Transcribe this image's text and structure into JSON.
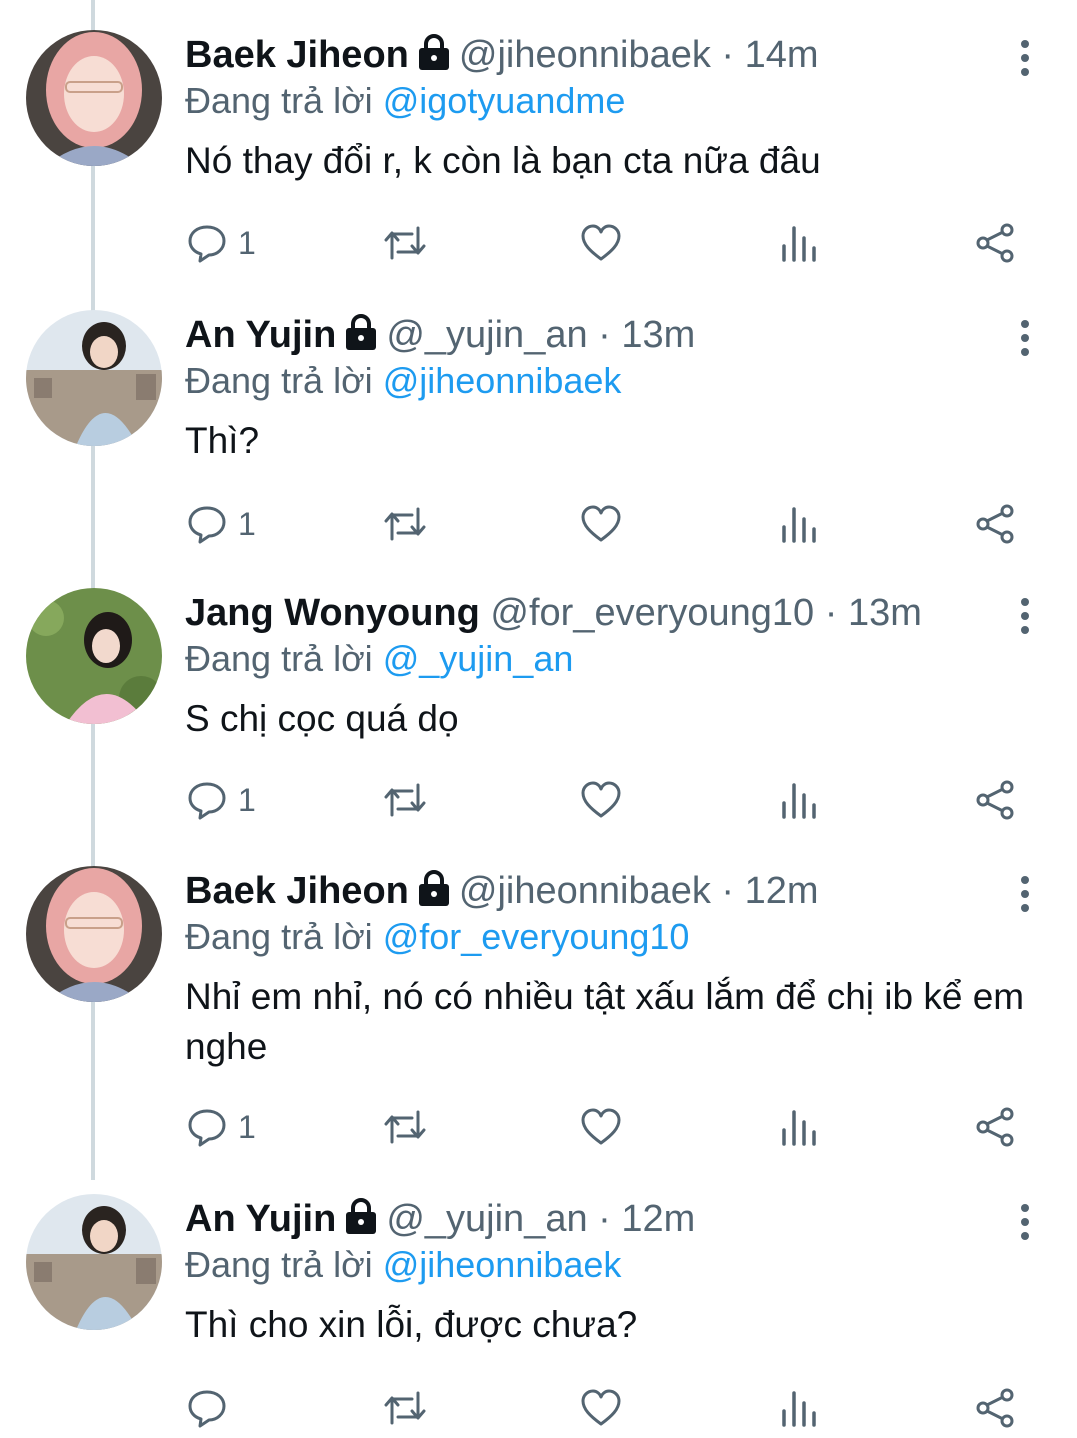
{
  "ui": {
    "reply_prefix": "Đang trả lời",
    "dot": "·"
  },
  "colors": {
    "text": "#0f1419",
    "secondary": "#536471",
    "link": "#1d9bf0",
    "thread_line": "#cfd9de"
  },
  "tweets": [
    {
      "name": "Baek Jiheon",
      "handle": "@jiheonnibaek",
      "time": "14m",
      "reply_to": "@igotyuandme",
      "text": "Nó thay đổi r, k còn là bạn cta nữa đâu",
      "reply_count": "1",
      "avatar": "pink-hair-avatar",
      "locked": true
    },
    {
      "name": "An Yujin",
      "handle": "@_yujin_an",
      "time": "13m",
      "reply_to": "@jiheonnibaek",
      "text": "Thì?",
      "reply_count": "1",
      "avatar": "city-view-avatar",
      "locked": true
    },
    {
      "name": "Jang Wonyoung",
      "handle": "@for_everyoung10",
      "time": "13m",
      "reply_to": "@_yujin_an",
      "text": "S chị cọc quá dọ",
      "reply_count": "1",
      "avatar": "grass-field-avatar",
      "locked": false
    },
    {
      "name": "Baek Jiheon",
      "handle": "@jiheonnibaek",
      "time": "12m",
      "reply_to": "@for_everyoung10",
      "text": "Nhỉ em nhỉ, nó có nhiều tật xấu lắm để chị ib kể em nghe",
      "reply_count": "1",
      "avatar": "pink-hair-avatar",
      "locked": true
    },
    {
      "name": "An Yujin",
      "handle": "@_yujin_an",
      "time": "12m",
      "reply_to": "@jiheonnibaek",
      "text": "Thì cho xin lỗi, được chưa?",
      "reply_count": "",
      "avatar": "city-view-avatar",
      "locked": true
    }
  ]
}
